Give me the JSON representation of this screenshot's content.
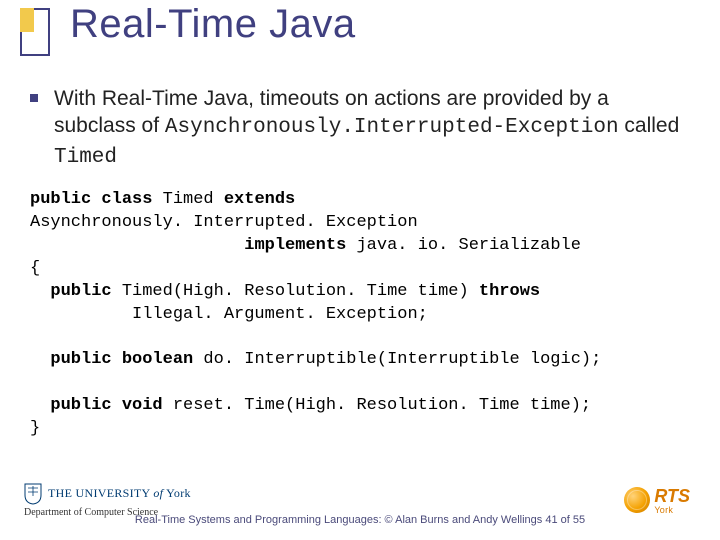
{
  "title": "Real-Time Java",
  "bullet": {
    "pre": "With Real-Time Java, timeouts on actions are provided by  a subclass of ",
    "mono1": "Asynchronously.Interrupted-Exception",
    "mid": " called ",
    "mono2": "Timed"
  },
  "code": {
    "l1a": "public class",
    "l1b": " Timed ",
    "l1c": "extends",
    "l2": "Asynchronously. Interrupted. Exception",
    "l3a": "                     ",
    "l3b": "implements",
    "l3c": " java. io. Serializable",
    "l4": "{",
    "l5a": "  ",
    "l5b": "public",
    "l5c": " Timed(High. Resolution. Time time) ",
    "l5d": "throws",
    "l6": "          Illegal. Argument. Exception;",
    "blank1": "",
    "l7a": "  ",
    "l7b": "public boolean",
    "l7c": " do. Interruptible(Interruptible logic);",
    "blank2": "",
    "l8a": "  ",
    "l8b": "public void",
    "l8c": " reset. Time(High. Resolution. Time time);",
    "l9": "}"
  },
  "footer": {
    "uoy_prefix": "THE UNIVERSITY ",
    "uoy_italic": "of",
    "uoy_suffix": " York",
    "dept": "Department of Computer Science",
    "center": "Real-Time Systems and Programming Languages: © Alan Burns and Andy Wellings  41 of 55",
    "rts": "RTS",
    "rts_sub": "York"
  }
}
